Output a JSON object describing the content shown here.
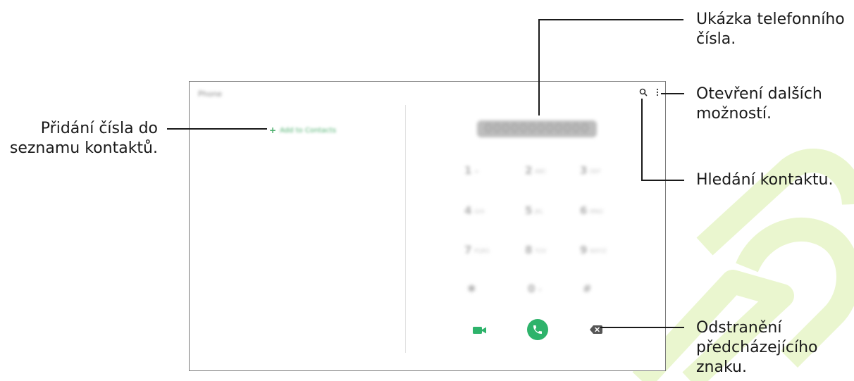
{
  "callouts": {
    "phone_number_preview": {
      "line1": "Ukázka telefonního",
      "line2": "čísla."
    },
    "more_options": {
      "line1": "Otevření dalších",
      "line2": "možností."
    },
    "search_contact": {
      "line1": "Hledání kontaktu."
    },
    "add_to_contacts": {
      "line1": "Přidání čísla do",
      "line2": "seznamu kontaktů."
    },
    "delete_character": {
      "line1": "Odstranění",
      "line2": "předcházejícího",
      "line3": "znaku."
    }
  },
  "screen": {
    "app_title": "Phone",
    "add_contact_label": "Add to Contacts",
    "number_display": "000000000000",
    "keypad": [
      {
        "digit": "1",
        "letters": "∞"
      },
      {
        "digit": "2",
        "letters": "ABC"
      },
      {
        "digit": "3",
        "letters": "DEF"
      },
      {
        "digit": "4",
        "letters": "GHI"
      },
      {
        "digit": "5",
        "letters": "JKL"
      },
      {
        "digit": "6",
        "letters": "MNO"
      },
      {
        "digit": "7",
        "letters": "PQRS"
      },
      {
        "digit": "8",
        "letters": "TUV"
      },
      {
        "digit": "9",
        "letters": "WXYZ"
      },
      {
        "digit": "✱",
        "letters": ""
      },
      {
        "digit": "0",
        "letters": "+"
      },
      {
        "digit": "#",
        "letters": ""
      }
    ],
    "icons": {
      "search": "search-icon",
      "more": "more-options-icon",
      "video_call": "video-call-icon",
      "call": "phone-call-icon",
      "backspace": "backspace-icon",
      "add": "plus-icon"
    },
    "colors": {
      "accent_green": "#2eb36b",
      "watermark_green": "#e6f4c8"
    }
  }
}
